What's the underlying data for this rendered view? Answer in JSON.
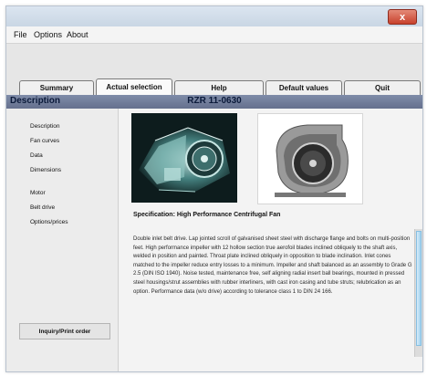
{
  "window": {
    "close_label": "x"
  },
  "menu": [
    "File",
    "Options",
    "About"
  ],
  "tabs": [
    {
      "label": "Summary",
      "active": false
    },
    {
      "label": "Actual selection",
      "active": true
    },
    {
      "label": "Help",
      "active": false
    },
    {
      "label": "Default values",
      "active": false
    },
    {
      "label": "Quit",
      "active": false
    }
  ],
  "header": {
    "section": "Description",
    "model": "RZR 11-0630"
  },
  "sidebar": {
    "items": [
      "Description",
      "Fan curves",
      "Data",
      "Dimensions",
      "Motor",
      "Belt drive",
      "Options/prices"
    ],
    "inquiry_button": "Inquiry/Print order"
  },
  "content": {
    "spec_title": "Specification: High Performance Centrifugal Fan",
    "description": "Double inlet belt drive. Lap jointed scroll of galvanised sheet steel with discharge flange and bolts on multi-position feet. High performance impeller with 12 hollow section true aerofoil blades inclined obliquely to the shaft axis, welded in position and painted. Throat plate inclined obliquely in opposition to blade inclination. Inlet cones matched to the impeller reduce entry losses to a minimum. Impeller and shaft balanced as an assembly to Grade G 2.5 (DIN ISO 1940). Noise tested, maintenance free, self aligning radial insert ball bearings, mounted in pressed steel housings/strut assemblies with rubber interliners, with cast iron casing and tube struts; relubrication as an option. Performance data (w/o drive) according to tolerance class 1 to DIN 24 166."
  },
  "colors": {
    "header_band": "#65708d",
    "header_text": "#0b1a3a",
    "scroll_thumb": "#9fd0ef",
    "close_button": "#c8412c"
  },
  "icons": [
    "close-icon"
  ]
}
